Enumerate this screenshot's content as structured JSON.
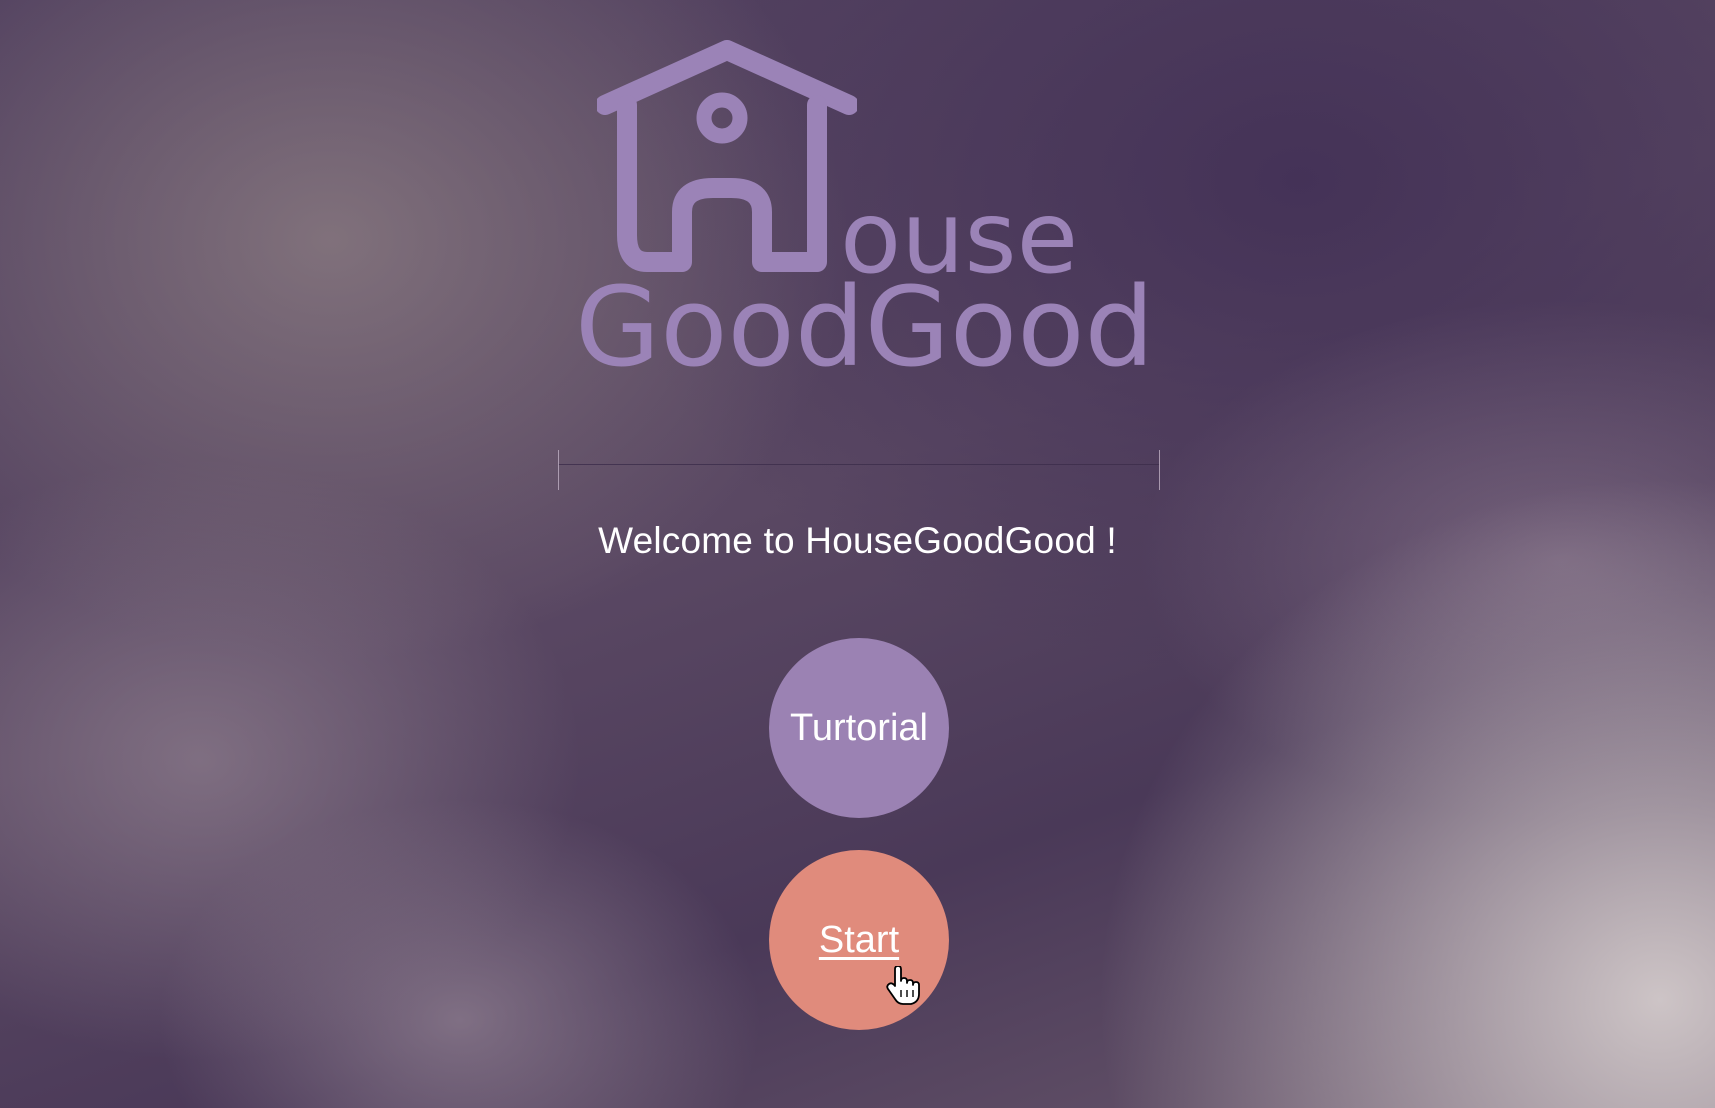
{
  "logo": {
    "word_top": "ouse",
    "word_bottom": "GoodGood",
    "icon": "house-icon",
    "color": "#9b83b7"
  },
  "welcome": {
    "text": "Welcome to HouseGoodGood !"
  },
  "buttons": {
    "tutorial": {
      "label": "Turtorial",
      "color": "#9b82b3"
    },
    "start": {
      "label": "Start",
      "color": "#e08b7c"
    }
  },
  "cursor": {
    "icon": "hand-pointer-icon"
  }
}
